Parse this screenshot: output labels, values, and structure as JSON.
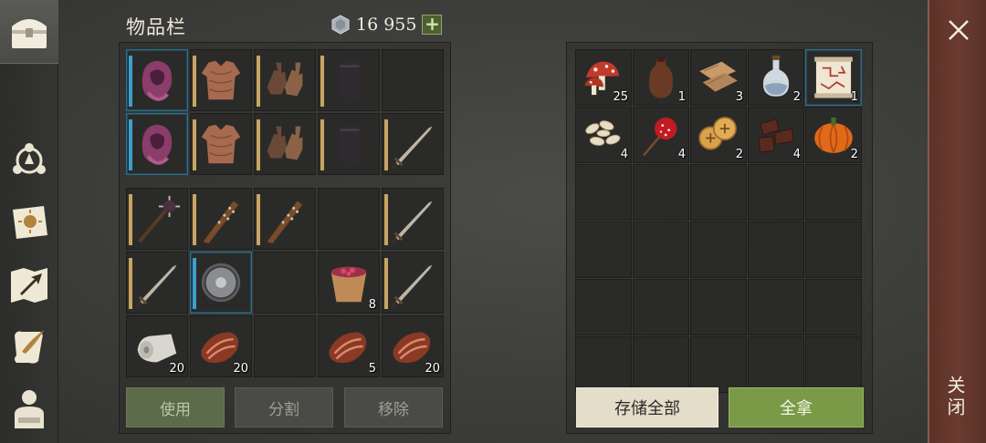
{
  "inventory": {
    "title": "物品栏",
    "currency_amount": "16 955",
    "add_currency_symbol": "+"
  },
  "equipment_rows": [
    [
      {
        "icon": "hood-icon",
        "count": "",
        "durability": "blue"
      },
      {
        "icon": "chest-armor-icon",
        "count": "",
        "durability": "tan"
      },
      {
        "icon": "gloves-icon",
        "count": "",
        "durability": "tan"
      },
      {
        "icon": "pants-icon",
        "count": "",
        "durability": "tan"
      },
      {
        "icon": "",
        "count": "",
        "durability": ""
      }
    ],
    [
      {
        "icon": "hood-icon",
        "count": "",
        "durability": "blue"
      },
      {
        "icon": "chest-armor-icon",
        "count": "",
        "durability": "tan"
      },
      {
        "icon": "gloves-icon",
        "count": "",
        "durability": "tan"
      },
      {
        "icon": "pants-icon",
        "count": "",
        "durability": "tan"
      },
      {
        "icon": "sword-icon",
        "count": "",
        "durability": "tan"
      }
    ]
  ],
  "backpack_rows": [
    [
      {
        "icon": "spiked-mace-icon",
        "count": "",
        "durability": "tan"
      },
      {
        "icon": "spiked-club-icon",
        "count": "",
        "durability": "tan"
      },
      {
        "icon": "spiked-club-icon",
        "count": "",
        "durability": "tan"
      },
      {
        "icon": "",
        "count": "",
        "durability": ""
      },
      {
        "icon": "sword-icon",
        "count": "",
        "durability": "tan"
      }
    ],
    [
      {
        "icon": "sword-icon",
        "count": "",
        "durability": "tan"
      },
      {
        "icon": "shield-icon",
        "count": "",
        "durability": "blue"
      },
      {
        "icon": "",
        "count": "",
        "durability": ""
      },
      {
        "icon": "berry-bucket-icon",
        "count": "8",
        "durability": ""
      },
      {
        "icon": "sword-icon",
        "count": "",
        "durability": "tan"
      }
    ],
    [
      {
        "icon": "cloth-roll-icon",
        "count": "20",
        "durability": ""
      },
      {
        "icon": "meat-icon",
        "count": "20",
        "durability": ""
      },
      {
        "icon": "",
        "count": "",
        "durability": ""
      },
      {
        "icon": "meat-icon",
        "count": "5",
        "durability": ""
      },
      {
        "icon": "meat-icon",
        "count": "20",
        "durability": ""
      }
    ]
  ],
  "actions": {
    "use": "使用",
    "split": "分割",
    "remove": "移除",
    "store_all": "存储全部",
    "take_all": "全拿",
    "close": "关闭"
  },
  "container_rows": [
    [
      {
        "icon": "mushroom-icon",
        "count": "25"
      },
      {
        "icon": "leather-bottle-icon",
        "count": "1"
      },
      {
        "icon": "cloth-scrap-icon",
        "count": "3"
      },
      {
        "icon": "potion-flask-icon",
        "count": "2"
      },
      {
        "icon": "recipe-scroll-icon",
        "count": "1",
        "highlight": true
      }
    ],
    [
      {
        "icon": "seeds-icon",
        "count": "4"
      },
      {
        "icon": "candy-apple-icon",
        "count": "4"
      },
      {
        "icon": "crackers-icon",
        "count": "2"
      },
      {
        "icon": "jerky-icon",
        "count": "4"
      },
      {
        "icon": "pumpkin-icon",
        "count": "2"
      }
    ],
    [
      {},
      {},
      {},
      {},
      {}
    ],
    [
      {},
      {},
      {},
      {},
      {}
    ],
    [
      {},
      {},
      {},
      {},
      {}
    ],
    [
      {},
      {},
      {},
      {},
      {}
    ]
  ],
  "colors": {
    "accent_blue": "#3ba0cf",
    "durability_tan": "#c9a463",
    "use_button_bg": "#5c6b4a",
    "take_all_bg": "#7a9a47",
    "close_bar": "#6a3a2e"
  }
}
